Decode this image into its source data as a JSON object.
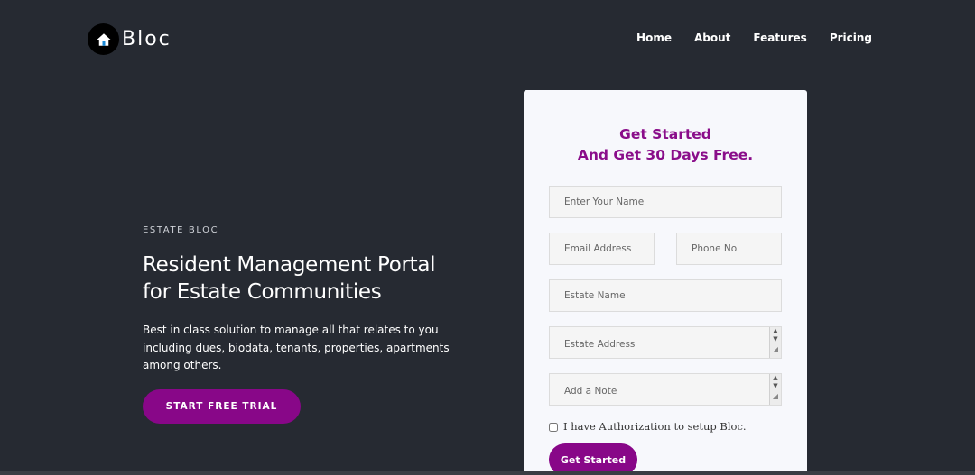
{
  "brand": {
    "name": "Bloc",
    "logo_icon": "home-icon"
  },
  "nav": [
    {
      "label": "Home"
    },
    {
      "label": "About"
    },
    {
      "label": "Features"
    },
    {
      "label": "Pricing"
    }
  ],
  "hero": {
    "eyebrow": "ESTATE BLOC",
    "headline_line1": "Resident Management Portal",
    "headline_line2": "for Estate Communities",
    "subtext": "Best in class solution to manage all that relates to you including dues, biodata, tenants, properties, apartments among others.",
    "cta_label": "START FREE TRIAL"
  },
  "form": {
    "title_line1": "Get Started",
    "title_line2": "And Get 30 Days Free.",
    "name_placeholder": "Enter Your Name",
    "email_placeholder": "Email Address",
    "phone_placeholder": "Phone No",
    "estate_name_placeholder": "Estate Name",
    "estate_address_placeholder": "Estate Address",
    "note_placeholder": "Add a Note",
    "consent_label": "I have Authorization to setup Bloc.",
    "submit_label": "Get Started"
  },
  "colors": {
    "background": "#262a32",
    "accent": "#880788",
    "card": "#f7f8fc"
  }
}
